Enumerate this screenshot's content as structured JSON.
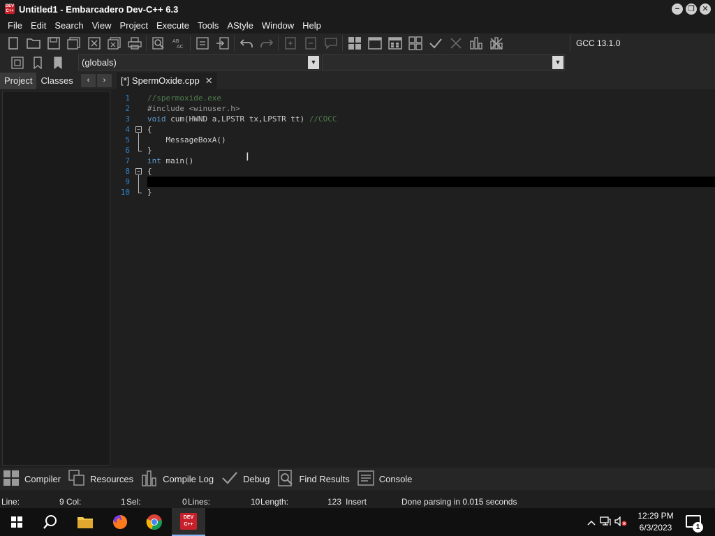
{
  "window": {
    "title": "Untitled1 - Embarcadero Dev-C++ 6.3",
    "app_icon_text": "DEV C++",
    "minimize": "−",
    "restore": "❐",
    "close": "✕"
  },
  "menu": [
    "File",
    "Edit",
    "Search",
    "View",
    "Project",
    "Execute",
    "Tools",
    "AStyle",
    "Window",
    "Help"
  ],
  "toolbar": {
    "compiler": "GCC 13.1.0",
    "scope": "(globals)",
    "member": ""
  },
  "left_panel": {
    "tabs": [
      "Project",
      "Classes"
    ],
    "prev": "‹",
    "next": "›"
  },
  "editor": {
    "tab_label": "[*] SpermOxide.cpp",
    "tab_close": "✕",
    "line_numbers": [
      "1",
      "2",
      "3",
      "4",
      "5",
      "6",
      "7",
      "8",
      "9",
      "10"
    ],
    "lines": {
      "l1": "//spermoxide.exe",
      "l2": "#include <winuser.h>",
      "l3_kw": "void",
      "l3_code": " cum(HWND a,LPSTR tx,LPSTR tt) ",
      "l3_comment": "//COCC",
      "l4": "{",
      "l5": "    MessageBoxA()",
      "l6": "}",
      "l7_kw": "int",
      "l7_code": " main()",
      "l8": "{",
      "l9": "",
      "l10": "}"
    }
  },
  "bottom_tabs": [
    "Compiler",
    "Resources",
    "Compile Log",
    "Debug",
    "Find Results",
    "Console"
  ],
  "status": {
    "line_label": "Line:",
    "line_value": "9",
    "col_label": "Col:",
    "col_value": "1",
    "sel_label": "Sel:",
    "sel_value": "0",
    "lines_label": "Lines:",
    "lines_value": "10",
    "length_label": "Length:",
    "length_value": "123",
    "mode": "Insert",
    "message": "Done parsing in 0.015 seconds"
  },
  "taskbar": {
    "time": "12:29 PM",
    "date": "6/3/2023",
    "notification_count": "1",
    "devcpp_label": "DEV C++"
  },
  "colors": {
    "line_number": "#2f82c8",
    "keyword": "#5f9ad1",
    "comment": "#4e7d4e",
    "app_red": "#c8202a"
  }
}
